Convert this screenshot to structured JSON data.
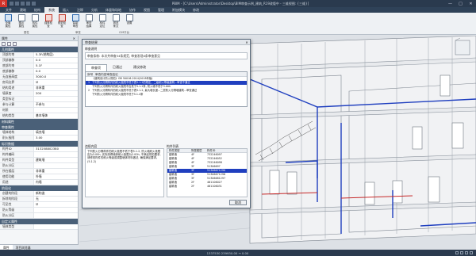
{
  "titlebar": {
    "app_icon": "R",
    "title": "PBIM - [C:\\Users\\Administrator\\Desktop\\BIM审查示例_建筑_R19改版中 - 三维视图: {三维}]",
    "minimize": "—",
    "maximize": "□",
    "close": "✕"
  },
  "menu": {
    "tabs": [
      "文件",
      "建筑",
      "结构",
      "系统",
      "插入",
      "注释",
      "分析",
      "体量和场地",
      "协作",
      "视图",
      "管理",
      "附加模块",
      "修改"
    ],
    "active_index": 3
  },
  "ribbon": {
    "buttons": [
      {
        "label": "全局\n属性",
        "icon": "globe-icon",
        "style": "blue"
      },
      {
        "label": "图示\n属性",
        "icon": "tag-icon",
        "style": ""
      },
      {
        "label": "构件\n属性",
        "icon": "cube-icon",
        "style": ""
      },
      {
        "label": "强条检\n查",
        "icon": "check-icon",
        "style": "red"
      },
      {
        "label": "规范检\n查",
        "icon": "doc-check-icon",
        "style": "red"
      },
      {
        "label": "智能\n审查",
        "icon": "robot-icon",
        "style": "blue"
      },
      {
        "label": "审查\n结果",
        "icon": "list-icon",
        "style": ""
      },
      {
        "label": "构件\n定位",
        "icon": "locate-icon",
        "style": ""
      },
      {
        "label": "规范\n条文",
        "icon": "book-icon",
        "style": ""
      },
      {
        "label": "设置",
        "icon": "gear-icon",
        "style": ""
      }
    ],
    "group_labels": [
      "属性",
      "审查",
      "CIM平台"
    ]
  },
  "left_panel": {
    "title": "属性",
    "close": "✕",
    "sections": [
      {
        "name": "几何属性",
        "rows": [
          {
            "k": "顶部约束",
            "v": "5.3F(结构层)"
          },
          {
            "k": "顶部偏移",
            "v": "0.0"
          },
          {
            "k": "底部约束",
            "v": "5.1F"
          },
          {
            "k": "底部偏移",
            "v": "0.0"
          },
          {
            "k": "无连接高度",
            "v": "3000.0"
          },
          {
            "k": "房间边界",
            "v": "☑"
          },
          {
            "k": "结构用途",
            "v": "非承重"
          },
          {
            "k": "墙厚度",
            "v": "200"
          },
          {
            "k": "类型标记",
            "v": ""
          },
          {
            "k": "参与计算",
            "v": "不参与"
          },
          {
            "k": "材质",
            "v": ""
          },
          {
            "k": "结构类型",
            "v": "基本墙体"
          }
        ]
      },
      {
        "name": "材料属性",
        "rows": []
      },
      {
        "name": "审查属性",
        "rows": [
          {
            "k": "墙体结构",
            "v": "填充墙"
          },
          {
            "k": "耐火极限",
            "v": "3.00"
          }
        ]
      },
      {
        "name": "标识数据",
        "rows": [
          {
            "k": "构件ID",
            "v": "313258802380"
          },
          {
            "k": "构件编码",
            "v": ""
          },
          {
            "k": "构件类型",
            "v": "建筑墙"
          },
          {
            "k": "防火分区",
            "v": ""
          },
          {
            "k": "所在楼层",
            "v": "非承重"
          },
          {
            "k": "使用功能",
            "v": "外墙"
          },
          {
            "k": "用途",
            "v": "内墙"
          }
        ]
      },
      {
        "name": "阶段化",
        "rows": [
          {
            "k": "创建的阶段",
            "v": "新构造"
          },
          {
            "k": "拆除的阶段",
            "v": "无"
          },
          {
            "k": "可见性",
            "v": "☑"
          },
          {
            "k": "防火等级",
            "v": ""
          },
          {
            "k": "防火分区",
            "v": ""
          }
        ]
      },
      {
        "name": "自定义属性",
        "rows": [
          {
            "k": "墙体类型",
            "v": ""
          }
        ]
      }
    ],
    "help_link": "属性帮助",
    "apply": "应用",
    "bottom_tabs": [
      "属性",
      "项目浏览器"
    ]
  },
  "dialog": {
    "title": "审查结果",
    "close": "✕",
    "note_label": "审查说明",
    "note_text": "审查条款: 本次共审查34条规范, 审查发现6条审查意见",
    "tabs": [
      "审查项",
      "已通过",
      "建议修改"
    ],
    "active_tab": 0,
    "table_headers": [
      "序号",
      "审查内容审查结论"
    ],
    "rows": [
      {
        "n": "",
        "t": "《建筑设计防火规范》GB 50016-2014(2018年版)",
        "sel": false
      },
      {
        "n": "1",
        "t": "  下列防火分隔构件的耐火极限不低于表5.1.2的规定，二级耐火等级建筑...审查不通过",
        "sel": true
      },
      {
        "n": "",
        "t": "      下列防火分隔构件的耐火极限不应低于5.1.2条, 防火墙不低于3.00h",
        "sel": false
      },
      {
        "n": "2",
        "t": "  下列防火分隔构件的耐火极限不低于表5.1.2, 最大墙长度...二层防火分隔墙建筑...审查通过",
        "sel": false
      },
      {
        "n": "",
        "t": "      下列防火分隔构件的耐火极限不低于5.1.4条",
        "sel": false
      }
    ],
    "desc_label": "违规内容",
    "desc_text": "下列防火分隔构件的耐火极限不低于表5.1.2, 防火墙耐火极限应为3.00h, 实际测得墙体耐火极限为2.00h, 不满足规范要求, 请修改构件的耐火等级或调整墙体材料做法, 确保满足要求。(5.1.2)",
    "list_label": "构件列表",
    "list_headers": [
      "构件类型",
      "所属楼层",
      "构件ID"
    ],
    "list_rows": [
      {
        "a": "建筑墙",
        "b": "4F",
        "c": "732246097",
        "sel": false
      },
      {
        "a": "建筑墙",
        "b": "4F",
        "c": "732246052",
        "sel": false
      },
      {
        "a": "建筑墙",
        "b": "4F",
        "c": "732246098",
        "sel": false
      },
      {
        "a": "建筑墙",
        "b": "3F",
        "c": "51306697",
        "sel": false
      },
      {
        "a": "建筑墙",
        "b": "3F",
        "c": "51306671290",
        "sel": true
      },
      {
        "a": "建筑墙",
        "b": "3F",
        "c": "51306671296",
        "sel": false
      },
      {
        "a": "建筑墙",
        "b": "3F",
        "c": "51306681297",
        "sel": false
      },
      {
        "a": "建筑墙",
        "b": "2F",
        "c": "461106027",
        "sel": false
      },
      {
        "a": "建筑墙",
        "b": "2F",
        "c": "461106031",
        "sel": false
      }
    ],
    "ok_label": "取消"
  },
  "statusbar": {
    "text": "1337530  239930.00  → 0.00",
    "icons": [
      "filter-icon",
      "lock-icon",
      "select-icon",
      "cube-icon"
    ]
  }
}
